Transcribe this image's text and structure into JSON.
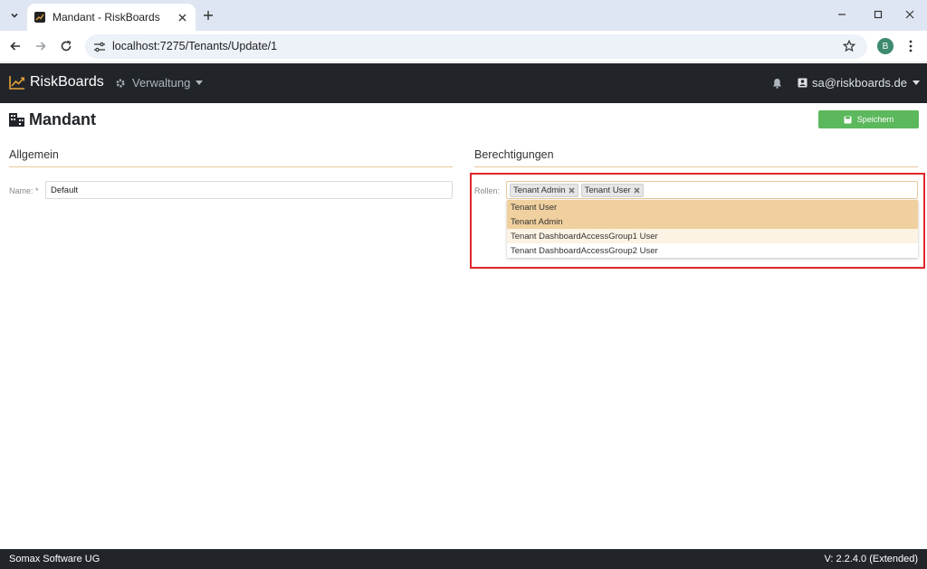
{
  "browser": {
    "tab_title": "Mandant - RiskBoards",
    "url": "localhost:7275/Tenants/Update/1",
    "profile_initial": "B"
  },
  "app": {
    "brand": "RiskBoards",
    "nav_menu": "Verwaltung",
    "user": "sa@riskboards.de"
  },
  "page": {
    "title": "Mandant",
    "save_label": "Speichern"
  },
  "general": {
    "heading": "Allgemein",
    "name_label": "Name: *",
    "name_value": "Default"
  },
  "permissions": {
    "heading": "Berechtigungen",
    "roles_label": "Rollen:",
    "selected_roles": [
      "Tenant Admin",
      "Tenant User"
    ],
    "options": [
      {
        "label": "Tenant User",
        "state": "selected"
      },
      {
        "label": "Tenant Admin",
        "state": "selected"
      },
      {
        "label": "Tenant DashboardAccessGroup1 User",
        "state": "hover"
      },
      {
        "label": "Tenant DashboardAccessGroup2 User",
        "state": "none"
      }
    ]
  },
  "footer": {
    "company": "Somax Software UG",
    "version": "V: 2.2.4.0 (Extended)"
  },
  "colors": {
    "navbar": "#212529",
    "accent": "#e8a33c",
    "save_button": "#5cb85c",
    "selected_option": "#f0d09e",
    "highlight": "#e0262b"
  }
}
